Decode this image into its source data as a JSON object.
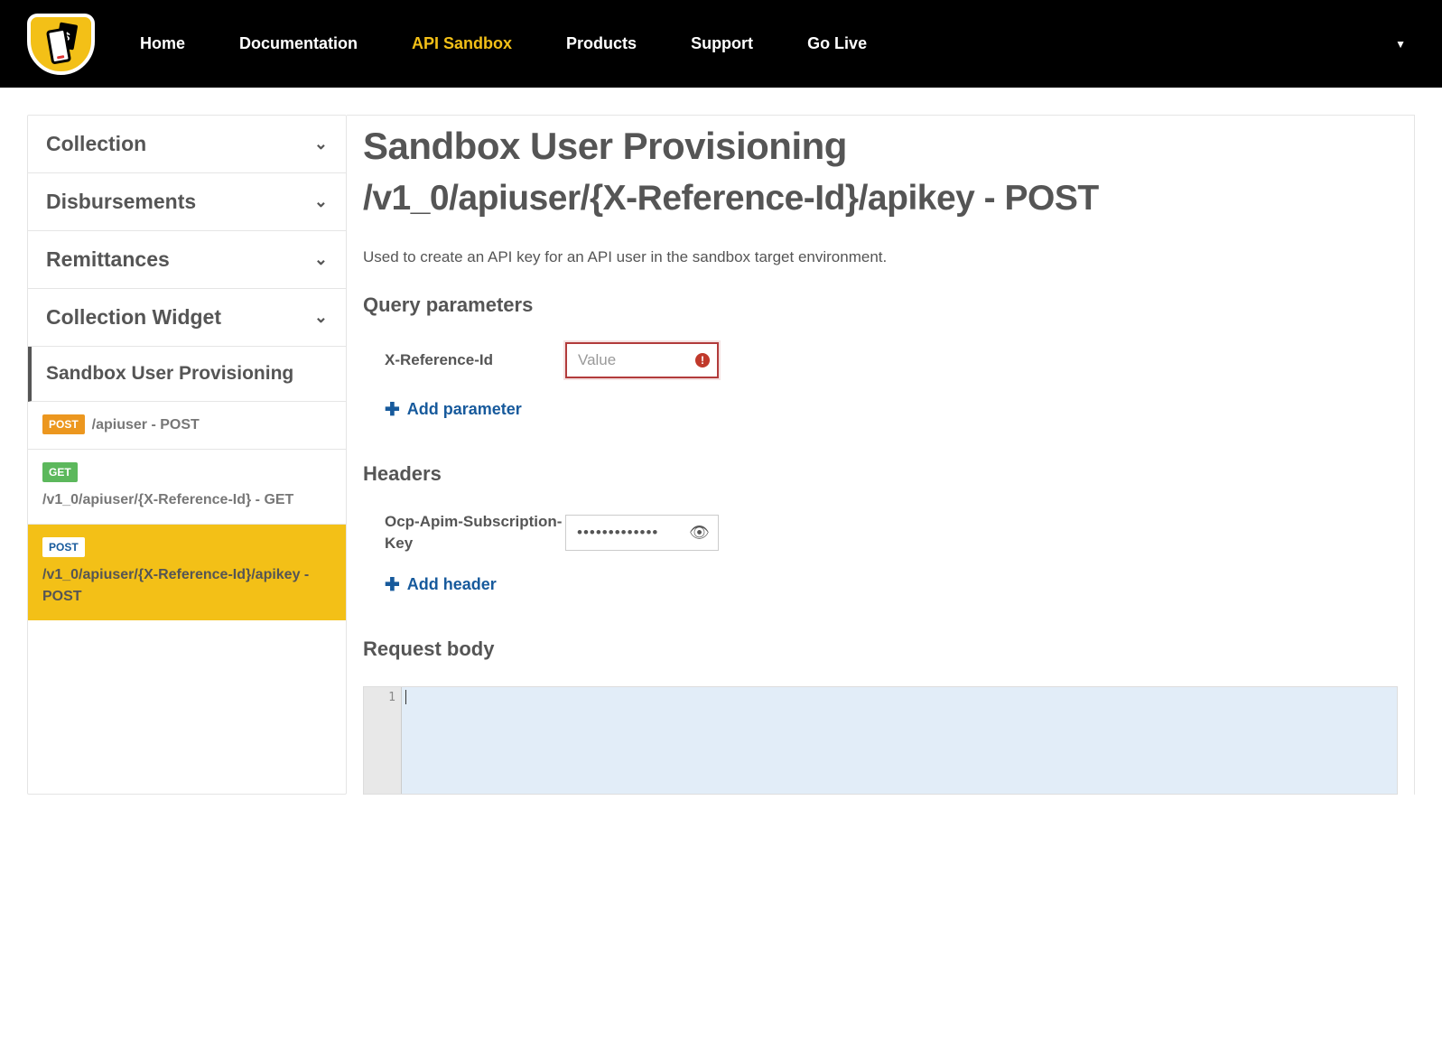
{
  "nav": {
    "items": [
      "Home",
      "Documentation",
      "API Sandbox",
      "Products",
      "Support",
      "Go Live"
    ],
    "active_index": 2
  },
  "sidebar": {
    "sections": [
      {
        "title": "Collection",
        "expanded": false
      },
      {
        "title": "Disbursements",
        "expanded": false
      },
      {
        "title": "Remittances",
        "expanded": false
      },
      {
        "title": "Collection Widget",
        "expanded": false
      },
      {
        "title": "Sandbox User Provisioning",
        "expanded": true,
        "active": true
      }
    ],
    "endpoints": [
      {
        "method": "POST",
        "method_class": "method-post",
        "label": "/apiuser - POST",
        "selected": false
      },
      {
        "method": "GET",
        "method_class": "method-get",
        "label": "/v1_0/apiuser/{X-Reference-Id} - GET",
        "selected": false
      },
      {
        "method": "POST",
        "method_class": "on-yellow",
        "label": "/v1_0/apiuser/{X-Reference-Id}/apikey - POST",
        "selected": true
      }
    ]
  },
  "main": {
    "title": "Sandbox User Provisioning",
    "endpoint_heading": "/v1_0/apiuser/{X-Reference-Id}/apikey - POST",
    "description": "Used to create an API key for an API user in the sandbox target environment.",
    "query_params_heading": "Query parameters",
    "query_params": [
      {
        "name": "X-Reference-Id",
        "placeholder": "Value",
        "value": "",
        "has_error": true
      }
    ],
    "add_parameter_label": "Add parameter",
    "headers_heading": "Headers",
    "headers": [
      {
        "name": "Ocp-Apim-Subscription-Key",
        "value": "•••••••••••••"
      }
    ],
    "add_header_label": "Add header",
    "request_body_heading": "Request body",
    "code_line_number": "1"
  }
}
